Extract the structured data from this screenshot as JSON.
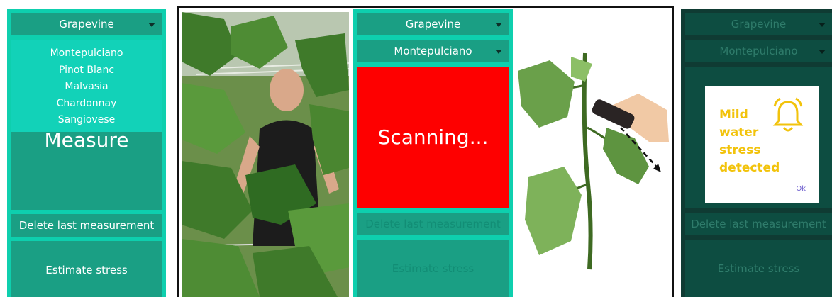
{
  "panel1": {
    "dropdown": "Grapevine",
    "menu_options": [
      "Montepulciano",
      "Pinot Blanc",
      "Malvasia",
      "Chardonnay",
      "Sangiovese"
    ],
    "measure_label": "Measure",
    "delete_label": "Delete last measurement",
    "estimate_label": "Estimate stress"
  },
  "panel3": {
    "dropdown_species": "Grapevine",
    "dropdown_variety": "Montepulciano",
    "scan_label": "Scanning...",
    "delete_label": "Delete last measurement",
    "estimate_label": "Estimate stress"
  },
  "panel4": {
    "dropdown_species": "Grapevine",
    "dropdown_variety": "Montepulciano",
    "dialog_message": "Mild water stress detected",
    "dialog_ok": "Ok",
    "delete_label": "Delete last measurement",
    "estimate_label": "Estimate stress"
  },
  "colors": {
    "panel_bg": "#0ecfae",
    "button_bg": "#1a9f84",
    "scan_red": "#fe0000",
    "alert_yellow": "#f2c30c",
    "dim_panel_bg": "#0f3b33"
  },
  "icons": [
    "chevron-down-icon",
    "bell-icon",
    "dashed-arrow-icon"
  ]
}
